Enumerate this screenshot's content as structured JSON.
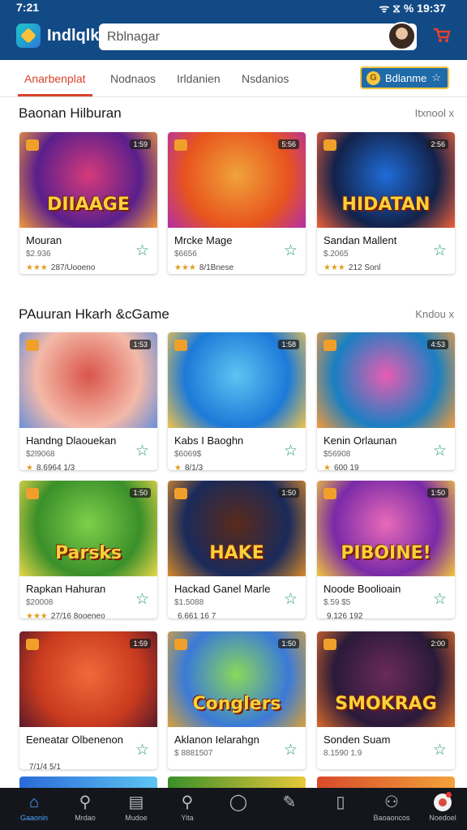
{
  "status": {
    "time": "7:21",
    "right_text": "ᯤ ⧖ %  19:37"
  },
  "header": {
    "app_name": "Indlqlk",
    "search_placeholder": "Rblnagar",
    "cart_icon": "cart-icon"
  },
  "tabs": [
    {
      "label": "Anarbenplat",
      "active": true
    },
    {
      "label": "Nodnaos",
      "active": false
    },
    {
      "label": "Irldanien",
      "active": false
    },
    {
      "label": "Nsdanios",
      "active": false
    }
  ],
  "balance": {
    "label": "Bdlanme",
    "coin_symbol": "G",
    "star": "☆"
  },
  "sections": [
    {
      "title": "Baonan Hilburan",
      "more": "Itxnool x",
      "cards": [
        {
          "name": "Mouran",
          "price": "$2.936",
          "stars": "★★★",
          "rating": "287/Uooeno",
          "tag": "1:59",
          "art": "DIIAAGE",
          "colors": [
            "#5a1f8c",
            "#d63a7a",
            "#f29b3b"
          ]
        },
        {
          "name": "Mrcke Mage",
          "price": "$6656",
          "stars": "★★★",
          "rating": "8/1Bnese",
          "tag": "5:56",
          "art": "",
          "colors": [
            "#e8541e",
            "#f0a33a",
            "#b22fa8"
          ]
        },
        {
          "name": "Sandan Mallent",
          "price": "$.2065",
          "stars": "★★★",
          "rating": "212 Sonl",
          "tag": "2:56",
          "art": "HIDATAN",
          "colors": [
            "#12224a",
            "#1f6cd8",
            "#f0613a"
          ]
        }
      ]
    },
    {
      "title": "PAuuran Hkarh &cGame",
      "more": "Kndou x",
      "cards": [
        {
          "name": "Handng Dlaouekan",
          "price": "$2l9068",
          "stars": "★",
          "rating": "8.6964 1/3",
          "tag": "1:53",
          "art": "",
          "colors": [
            "#f4b9a8",
            "#d9554a",
            "#6a8fd8"
          ]
        },
        {
          "name": "Kabs I Baoghn",
          "price": "$6069$",
          "stars": "★",
          "rating": "8/1/3",
          "tag": "1:58",
          "art": "",
          "colors": [
            "#1d7ad8",
            "#5ec4f2",
            "#f2c34a"
          ]
        },
        {
          "name": "Kenin Orlaunan",
          "price": "$56908",
          "stars": "★",
          "rating": "600 19",
          "tag": "4:53",
          "art": "",
          "colors": [
            "#1a7fc2",
            "#e85db2",
            "#f59a3b"
          ]
        }
      ]
    },
    {
      "title": "",
      "more": "",
      "cards": [
        {
          "name": "Rapkan Hahuran",
          "price": "$20008",
          "stars": "★★★",
          "rating": "27/16 8ooeneo",
          "tag": "1:50",
          "art": "Parsks",
          "colors": [
            "#3a8f2a",
            "#7ed04a",
            "#e8d84a"
          ]
        },
        {
          "name": "Hackad Ganel Marle",
          "price": "$1.5088",
          "stars": "",
          "rating": "6.661 16 7",
          "tag": "1:50",
          "art": "HAKE",
          "colors": [
            "#1a2a5a",
            "#5a2a1a",
            "#d88a2a"
          ]
        },
        {
          "name": "Noode Boolioain",
          "price": "$.59 $5",
          "stars": "",
          "rating": "9.126 192",
          "tag": "1:50",
          "art": "PIBOINE!",
          "colors": [
            "#7a2aa8",
            "#e86ab8",
            "#f4c83a"
          ]
        }
      ]
    },
    {
      "title": "",
      "more": "",
      "cards": [
        {
          "name": "Eeneatar Olbenenon",
          "price": "",
          "stars": "",
          "rating": "7/1/4 5/1",
          "tag": "1:59",
          "art": "",
          "colors": [
            "#c83a1e",
            "#f06a3a",
            "#5a1a2a"
          ]
        },
        {
          "name": "Aklanon Ielarahgn",
          "price": "$ 8881507",
          "stars": "",
          "rating": "",
          "tag": "1:50",
          "art": "Conglers",
          "colors": [
            "#3a7ad8",
            "#8ad85a",
            "#d8a23a"
          ]
        },
        {
          "name": "Sonden Suam",
          "price": "8.1590 1.9",
          "stars": "",
          "rating": "",
          "tag": "2:00",
          "art": "SMOKRAG",
          "colors": [
            "#2a1a3a",
            "#6a2a5a",
            "#d86a2a"
          ]
        }
      ]
    }
  ],
  "bottom_nav": [
    {
      "label": "Gaaonin",
      "icon": "home-icon",
      "glyph": "⌂",
      "active": true
    },
    {
      "label": "Mrdao",
      "icon": "search-icon",
      "glyph": "⚲",
      "active": false
    },
    {
      "label": "Mudoe",
      "icon": "library-icon",
      "glyph": "▤",
      "active": false
    },
    {
      "label": "Yita",
      "icon": "explore-icon",
      "glyph": "⚲",
      "active": false
    },
    {
      "label": "",
      "icon": "circle-icon",
      "glyph": "◯",
      "active": false
    },
    {
      "label": "",
      "icon": "pen-icon",
      "glyph": "✎",
      "active": false
    },
    {
      "label": "",
      "icon": "device-icon",
      "glyph": "▯",
      "active": false
    },
    {
      "label": "Baoaoncos",
      "icon": "account-icon",
      "glyph": "⚇",
      "active": false
    },
    {
      "label": "Noedoel",
      "icon": "profile-avatar",
      "glyph": "",
      "active": false
    }
  ]
}
